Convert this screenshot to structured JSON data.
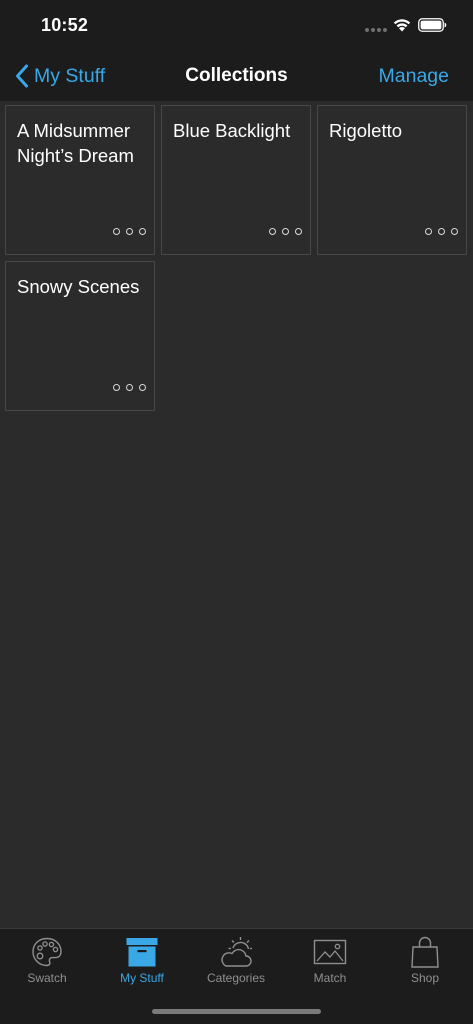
{
  "status_bar": {
    "time": "10:52"
  },
  "nav": {
    "back_label": "My Stuff",
    "title": "Collections",
    "manage_label": "Manage"
  },
  "collections": [
    {
      "title": "A Midsummer Night’s Dream"
    },
    {
      "title": "Blue Backlight"
    },
    {
      "title": "Rigoletto"
    },
    {
      "title": "Snowy Scenes"
    }
  ],
  "tabs": [
    {
      "label": "Swatch",
      "icon": "palette-icon",
      "active": false
    },
    {
      "label": "My Stuff",
      "icon": "archive-box-icon",
      "active": true
    },
    {
      "label": "Categories",
      "icon": "weather-icon",
      "active": false
    },
    {
      "label": "Match",
      "icon": "image-icon",
      "active": false
    },
    {
      "label": "Shop",
      "icon": "shopping-bag-icon",
      "active": false
    }
  ],
  "colors": {
    "accent": "#3aa8e6",
    "background": "#2b2b2b",
    "bar_background": "#1c1c1d",
    "card_border": "#474747",
    "inactive_tab": "#8f8f8f"
  }
}
